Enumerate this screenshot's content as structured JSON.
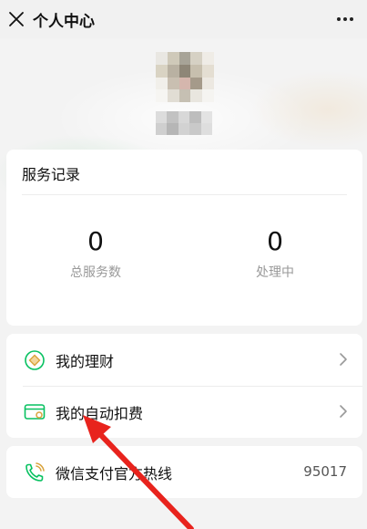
{
  "header": {
    "title": "个人中心",
    "close_icon": "close-icon",
    "more_icon": "more-icon"
  },
  "profile": {
    "avatar": "pixelated",
    "nickname": "pixelated"
  },
  "service_records": {
    "title": "服务记录",
    "stats": [
      {
        "value": "0",
        "label": "总服务数"
      },
      {
        "value": "0",
        "label": "处理中"
      }
    ]
  },
  "menu": {
    "items": [
      {
        "label": "我的理财",
        "icon": "wealth-icon"
      },
      {
        "label": "我的自动扣费",
        "icon": "auto-deduct-icon"
      }
    ]
  },
  "hotline": {
    "label": "微信支付官方热线",
    "number": "95017",
    "icon": "phone-icon"
  },
  "colors": {
    "accent": "#07c160",
    "annotation": "#e8231d",
    "icon_gold": "#d9a33b"
  }
}
